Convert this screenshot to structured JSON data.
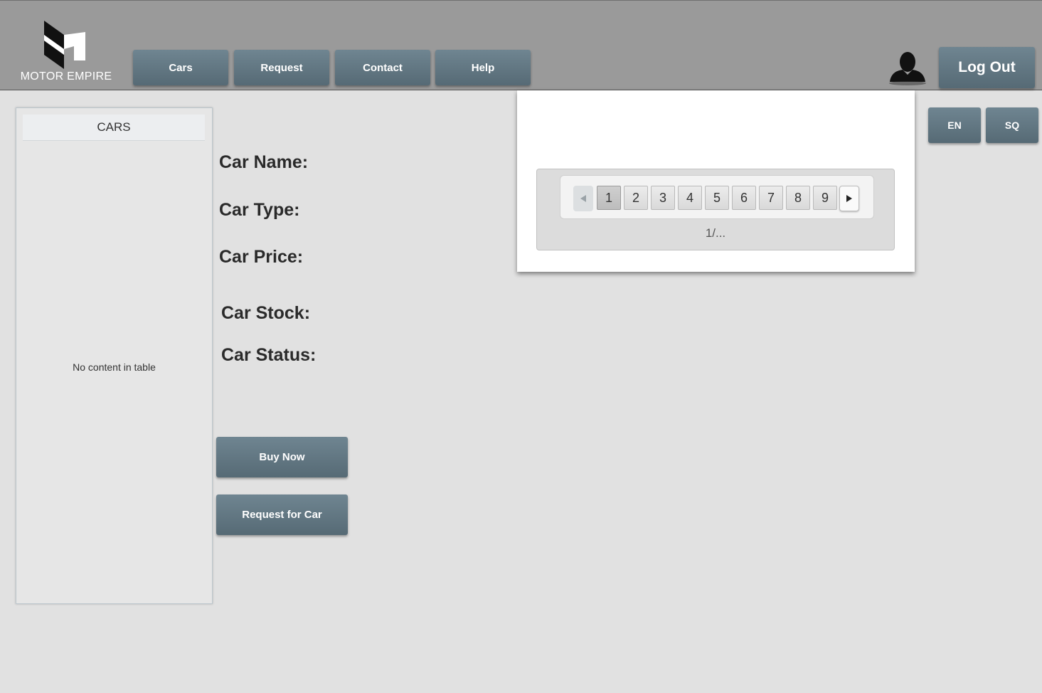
{
  "header": {
    "brand": "MOTOR EMPIRE",
    "nav": [
      {
        "label": "Cars"
      },
      {
        "label": "Request"
      },
      {
        "label": "Contact"
      },
      {
        "label": "Help"
      }
    ],
    "logout_label": "Log Out",
    "avatar_icon": "user-silhouette-icon"
  },
  "languages": [
    "EN",
    "SQ"
  ],
  "cars_table": {
    "header": "CARS",
    "empty_text": "No content in table"
  },
  "details": {
    "name_label": "Car Name:",
    "type_label": "Car Type:",
    "price_label": "Car Price:",
    "stock_label": "Car Stock:",
    "status_label": "Car Status:"
  },
  "actions": {
    "buy_label": "Buy Now",
    "request_label": "Request for Car"
  },
  "pagination": {
    "pages": [
      "1",
      "2",
      "3",
      "4",
      "5",
      "6",
      "7",
      "8",
      "9"
    ],
    "current_page": "1",
    "indicator": "1/...",
    "prev_icon": "triangle-left-icon",
    "next_icon": "triangle-right-icon"
  },
  "colors": {
    "topbar": "#9a9a9a",
    "button": "#607580",
    "background": "#e1e1e1"
  }
}
